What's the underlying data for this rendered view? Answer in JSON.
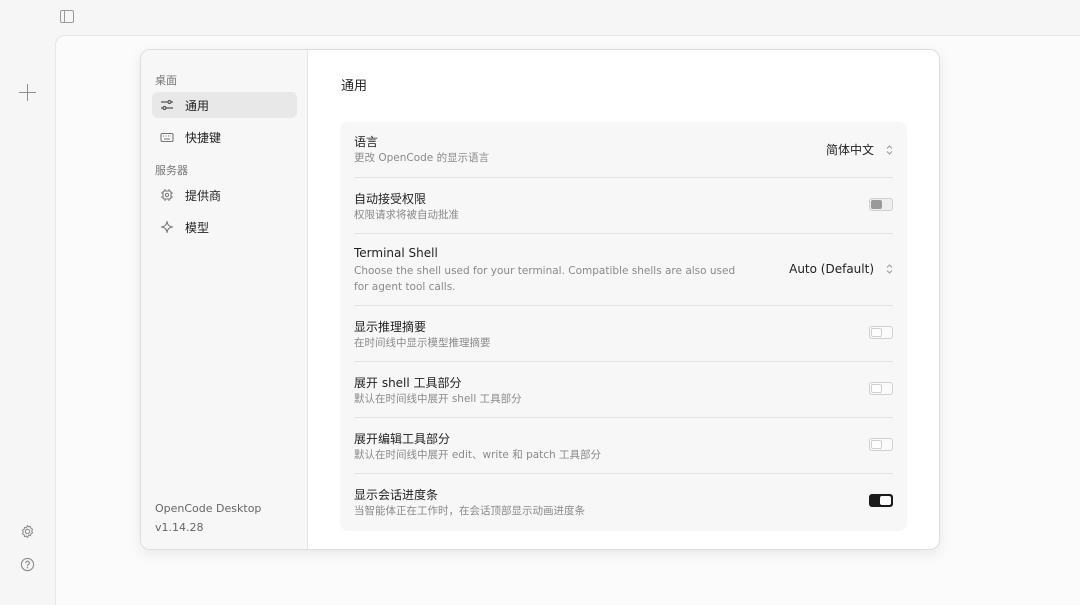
{
  "nav": {
    "section_desktop": "桌面",
    "item_general": "通用",
    "item_shortcuts": "快捷键",
    "section_server": "服务器",
    "item_providers": "提供商",
    "item_models": "模型",
    "app_name": "OpenCode Desktop",
    "version": "v1.14.28"
  },
  "page": {
    "title": "通用"
  },
  "settings": {
    "language": {
      "title": "语言",
      "desc": "更改 OpenCode 的显示语言",
      "value": "简体中文"
    },
    "auto_accept": {
      "title": "自动接受权限",
      "desc": "权限请求将被自动批准",
      "state": "disabled"
    },
    "terminal_shell": {
      "title": "Terminal Shell",
      "desc_line1": "Choose the shell used for your terminal. Compatible shells are also used",
      "desc_line2": "for agent tool calls.",
      "value": "Auto (Default)"
    },
    "show_reasoning": {
      "title": "显示推理摘要",
      "desc": "在时间线中显示模型推理摘要",
      "state": "off"
    },
    "expand_shell": {
      "title": "展开 shell 工具部分",
      "desc": "默认在时间线中展开 shell 工具部分",
      "state": "off"
    },
    "expand_edit": {
      "title": "展开编辑工具部分",
      "desc": "默认在时间线中展开 edit、write 和 patch 工具部分",
      "state": "off"
    },
    "progress_bar": {
      "title": "显示会话进度条",
      "desc": "当智能体正在工作时，在会话顶部显示动画进度条",
      "state": "on"
    }
  },
  "icons": {
    "panel": "sidebar-toggle-icon",
    "new": "plus-icon",
    "settings": "gear-icon",
    "help": "help-icon",
    "general": "sliders-icon",
    "shortcuts": "keyboard-icon",
    "providers": "chip-icon",
    "models": "sparkle-icon"
  }
}
